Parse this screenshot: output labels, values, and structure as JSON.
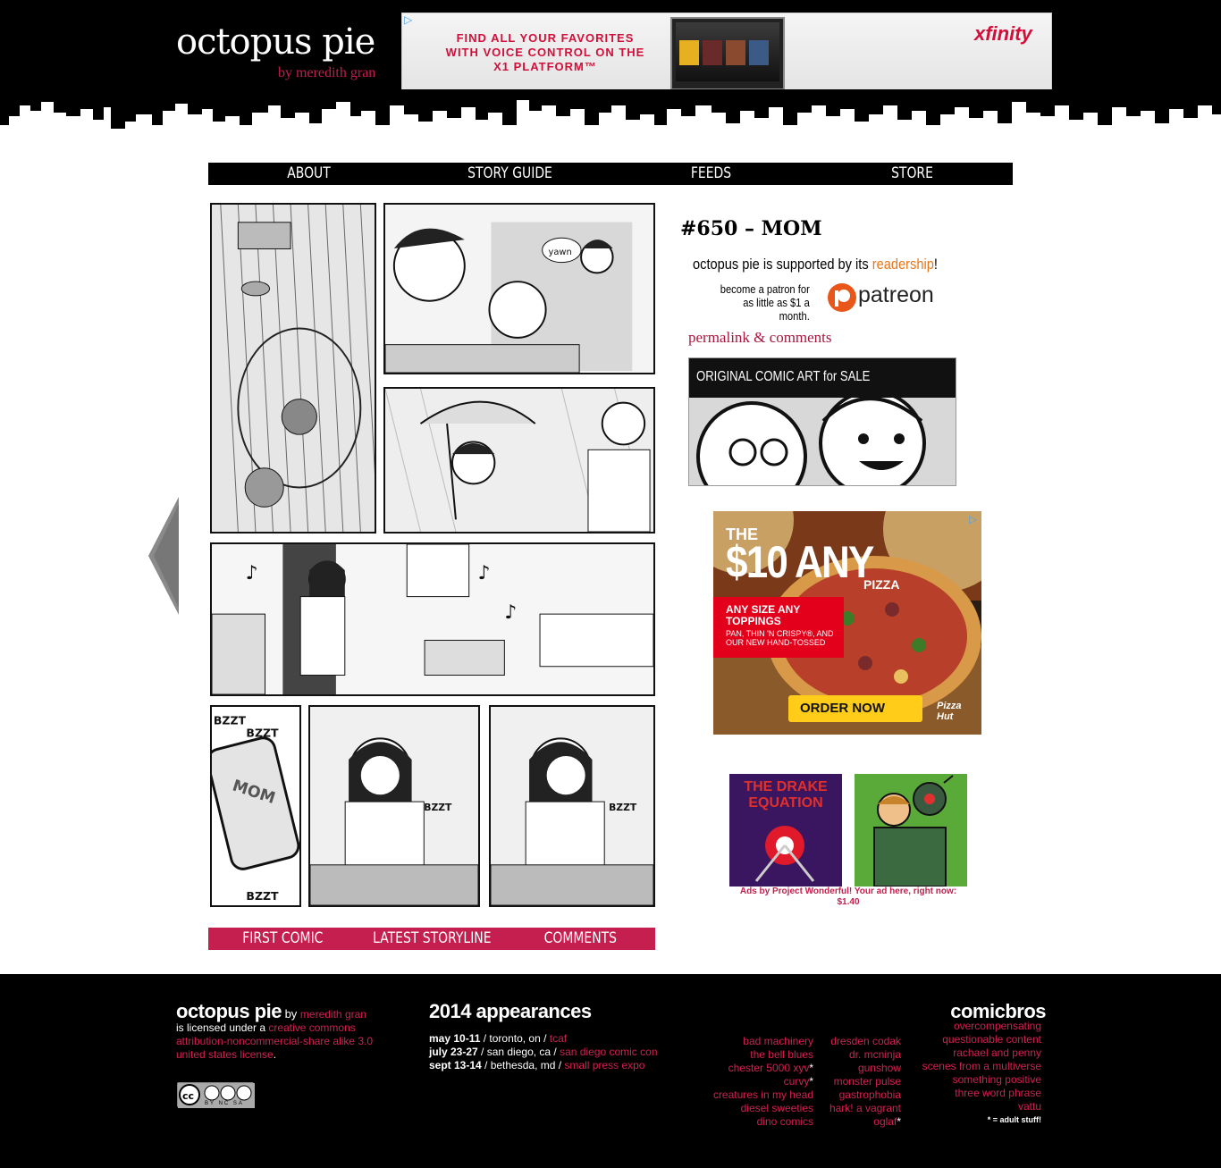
{
  "header": {
    "site_title": "octopus pie",
    "byline": "by meredith gran"
  },
  "top_ad": {
    "text": "FIND ALL YOUR FAVORITES WITH VOICE CONTROL ON THE X1 PLATFORM™",
    "brand": "xfinity",
    "adchoice": "▷"
  },
  "nav": {
    "items": [
      {
        "label": "ABOUT"
      },
      {
        "label": "STORY GUIDE"
      },
      {
        "label": "FEEDS"
      },
      {
        "label": "STORE"
      }
    ]
  },
  "comic": {
    "sfx": {
      "yawn": "yawn",
      "mom": "MOM",
      "bzzt": "BZZT",
      "bzzt_small": "BZZT"
    }
  },
  "comic_nav": {
    "items": [
      {
        "label": "FIRST COMIC"
      },
      {
        "label": "LATEST STORYLINE"
      },
      {
        "label": "COMMENTS"
      }
    ]
  },
  "post": {
    "title": "#650 – MOM",
    "permalink": "permalink & comments"
  },
  "patreon": {
    "line1_prefix": "octopus pie is supported by its ",
    "line1_highlight": "readership",
    "line1_suffix": "!",
    "line2": "become a patron for as little as $1 a month.",
    "logo_word": "patreon"
  },
  "art_sale": {
    "label": "ORIGINAL COMIC ART for SALE"
  },
  "pizza_ad": {
    "line1": "THE",
    "line2": "$10 ANY",
    "line3": "PIZZA",
    "box_title": "ANY SIZE ANY TOPPINGS",
    "box_sub": "PAN, THIN 'N CRISPY®, AND OUR NEW HAND-TOSSED",
    "button": "ORDER NOW",
    "brand": "Pizza Hut"
  },
  "pw_ads": {
    "ad1_title": "THE DRAKE EQUATION",
    "caption": "Ads by Project Wonderful! Your ad here, right now: $1.40"
  },
  "footer": {
    "col1": {
      "name": "octopus pie",
      "by": " by ",
      "author": "meredith gran",
      "licensed": "is licensed under a ",
      "license_link": "creative commons attribution-noncommercial-share alike 3.0 united states license",
      "period": ".",
      "cc_label": "BY NC SA"
    },
    "appearances": {
      "title": "2014 appearances",
      "items": [
        {
          "date": "may 10-11",
          "place": " / toronto, on / ",
          "event": "tcaf"
        },
        {
          "date": "july 23-27",
          "place": " / san diego, ca / ",
          "event": "san diego comic con"
        },
        {
          "date": "sept 13-14",
          "place": " / bethesda, md / ",
          "event": "small press expo"
        }
      ]
    },
    "comicbros": {
      "title": "comicbros",
      "col_a": [
        "bad machinery",
        "the bell blues",
        "chester 5000 xyv",
        "curvy",
        "creatures in my head",
        "diesel sweeties",
        "dino comics"
      ],
      "col_a_star": [
        false,
        false,
        true,
        true,
        false,
        false,
        false
      ],
      "col_b": [
        "dresden codak",
        "dr. mcninja",
        "gunshow",
        "monster pulse",
        "gastrophobia",
        "hark! a vagrant",
        "oglaf"
      ],
      "col_b_star": [
        false,
        false,
        false,
        false,
        false,
        false,
        true
      ],
      "col_c": [
        "overcompensating",
        "questionable content",
        "rachael and penny",
        "scenes from a multiverse",
        "something positive",
        "three word phrase",
        "vattu"
      ],
      "note": "* = adult stuff!"
    }
  }
}
